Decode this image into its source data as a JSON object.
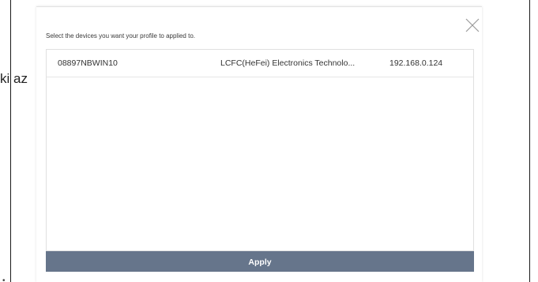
{
  "background": {
    "partial_text": "ki az"
  },
  "dialog": {
    "instruction": "Select the devices you want your profile to applied to.",
    "close_icon": "close-icon",
    "devices": [
      {
        "name": "08897NBWIN10",
        "vendor": "LCFC(HeFei) Electronics Technolo...",
        "ip": "192.168.0.124"
      }
    ],
    "apply_label": "Apply"
  },
  "colors": {
    "apply_button": "#66758b",
    "close_icon": "#9a9a9a"
  }
}
